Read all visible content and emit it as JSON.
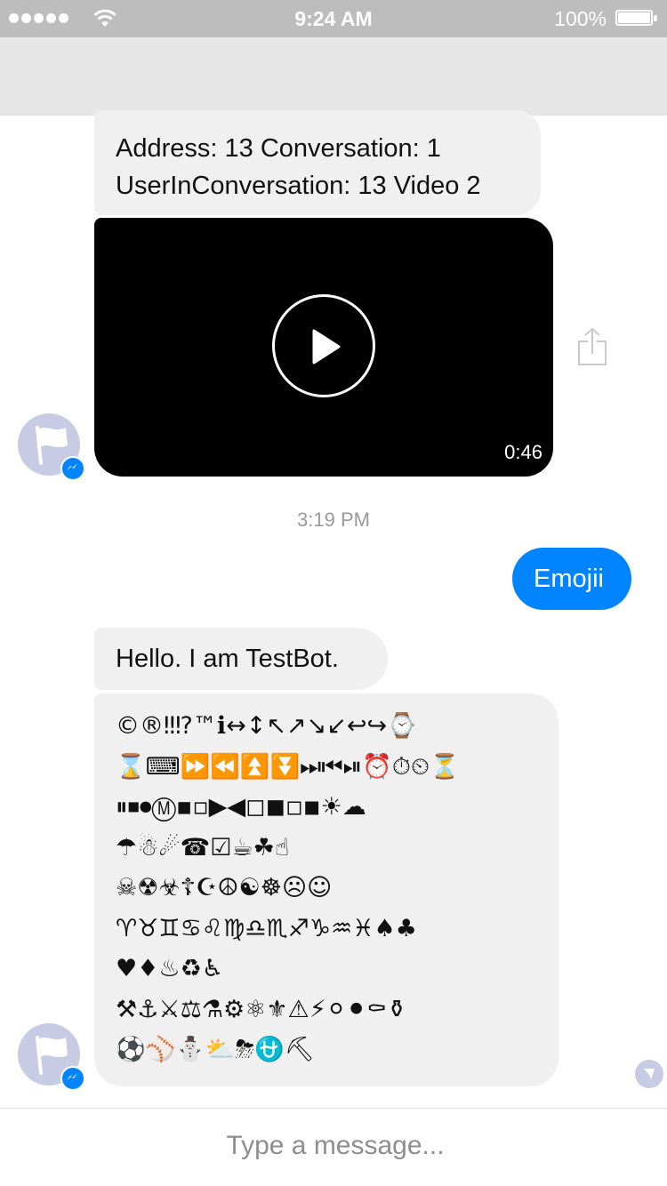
{
  "status_bar": {
    "time": "9:24 AM",
    "battery_pct": "100%",
    "signal_bars": 5
  },
  "messages": {
    "address_line1": "Address: 13 Conversation: 1",
    "address_line2": "UserInConversation: 13 Video 2",
    "video_duration": "0:46",
    "timestamp": "3:19 PM",
    "user_emojii": "Emojii",
    "hello": "Hello. I am TestBot.",
    "emoji_lines": [
      "©®‼⁉™ℹ↔↕↖↗↘↙↩↪⌚",
      "⌛⌨⏩⏪⏫⏬⏭⏮⏯⏰⏱⏲⏳",
      "⏸⏹⏺Ⓜ▪▫▶◀◻◼◽◾☀☁",
      "☂☃☄☎☑☕☘☝",
      "☠☢☣☦☪☮☯☸☹☺",
      "♈♉♊♋♌♍♎♏♐♑♒♓♠♣",
      "♥♦♨♻♿",
      "⚒⚓⚔⚖⚗⚙⚛⚜⚠⚡⚪⚫⚰⚱",
      "⚽⚾⛄⛅⛈⛎⛏"
    ]
  },
  "composer": {
    "placeholder": "Type a message..."
  },
  "colors": {
    "accent": "#0084ff",
    "incoming_bubble": "#f0f0f0",
    "status_bar": "#bdbdbd",
    "nav_bar": "#e6e6e6",
    "avatar": "#c7cbe3"
  },
  "icons": {
    "share": "share-icon",
    "play": "play-icon",
    "avatar_flag": "flag-icon",
    "messenger_badge": "messenger-icon",
    "seen": "seen-icon"
  }
}
